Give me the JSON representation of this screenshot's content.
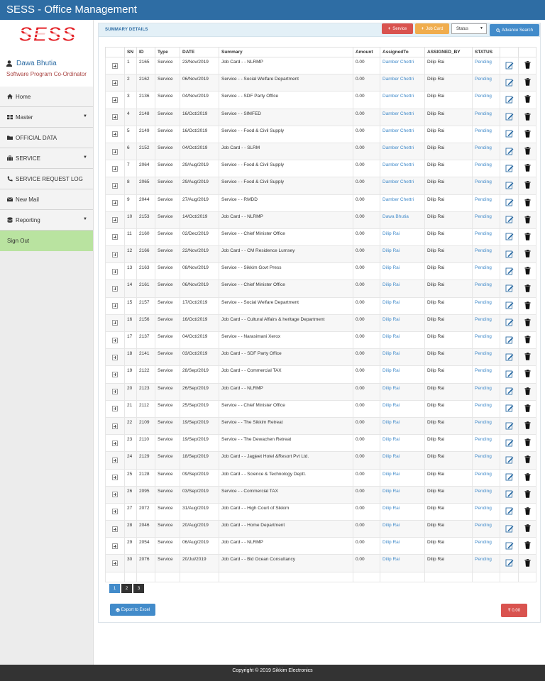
{
  "app": {
    "title": "SESS - Office Management"
  },
  "logo_text": "SESS",
  "user": {
    "name": "Dawa Bhutia",
    "role": "Software Program Co-Ordinator"
  },
  "menu": [
    {
      "label": "Home",
      "icon": "home-icon",
      "caret": false
    },
    {
      "label": "Master",
      "icon": "grid-icon",
      "caret": true
    },
    {
      "label": "OFFICIAL DATA",
      "icon": "folder-icon",
      "caret": false
    },
    {
      "label": "SERVICE",
      "icon": "briefcase-icon",
      "caret": true
    },
    {
      "label": "SERVICE REQUEST LOG",
      "icon": "phone-icon",
      "caret": false
    },
    {
      "label": "New Mail",
      "icon": "envelope-icon",
      "caret": false
    },
    {
      "label": "Reporting",
      "icon": "database-icon",
      "caret": true
    },
    {
      "label": "Sign Out",
      "icon": "",
      "caret": false
    }
  ],
  "summary": {
    "title": "SUMMARY DETAILS",
    "service_label": "Service",
    "jobcard_label": "Job Card",
    "status_label": "Status",
    "advance_search_label": "Advance Search"
  },
  "table": {
    "headers": [
      "",
      "SN",
      "ID",
      "Type",
      "DATE",
      "Summary",
      "Amount",
      "AssignedTo",
      "ASSIGNED_BY",
      "STATUS",
      "",
      ""
    ],
    "rows": [
      [
        "1",
        "2165",
        "Service",
        "23/Nov/2019",
        "Job Card - - NLRMP",
        "0.00",
        "Damber Chettri",
        "Dilip Rai",
        "Pending"
      ],
      [
        "2",
        "2162",
        "Service",
        "06/Nov/2019",
        "Service - - Social Welfare Department",
        "0.00",
        "Damber Chettri",
        "Dilip Rai",
        "Pending"
      ],
      [
        "3",
        "2136",
        "Service",
        "04/Nov/2019",
        "Service - - SDF Party Office",
        "0.00",
        "Damber Chettri",
        "Dilip Rai",
        "Pending"
      ],
      [
        "4",
        "2148",
        "Service",
        "16/Oct/2019",
        "Service - - SIMFED",
        "0.00",
        "Damber Chettri",
        "Dilip Rai",
        "Pending"
      ],
      [
        "5",
        "2149",
        "Service",
        "16/Oct/2019",
        "Service - - Food & Civil Supply",
        "0.00",
        "Damber Chettri",
        "Dilip Rai",
        "Pending"
      ],
      [
        "6",
        "2152",
        "Service",
        "04/Oct/2019",
        "Job Card - - SLRM",
        "0.00",
        "Damber Chettri",
        "Dilip Rai",
        "Pending"
      ],
      [
        "7",
        "2064",
        "Service",
        "29/Aug/2019",
        "Service - - Food & Civil Supply",
        "0.00",
        "Damber Chettri",
        "Dilip Rai",
        "Pending"
      ],
      [
        "8",
        "2065",
        "Service",
        "29/Aug/2019",
        "Service - - Food & Civil Supply",
        "0.00",
        "Damber Chettri",
        "Dilip Rai",
        "Pending"
      ],
      [
        "9",
        "2044",
        "Service",
        "27/Aug/2019",
        "Service - - RMDD",
        "0.00",
        "Damber Chettri",
        "Dilip Rai",
        "Pending"
      ],
      [
        "10",
        "2153",
        "Service",
        "14/Oct/2019",
        "Job Card - - NLRMP",
        "0.00",
        "Dawa Bhutia",
        "Dilip Rai",
        "Pending"
      ],
      [
        "11",
        "2160",
        "Service",
        "02/Dec/2019",
        "Service - - Chief Minister Office",
        "0.00",
        "Dilip Rai",
        "Dilip Rai",
        "Pending"
      ],
      [
        "12",
        "2166",
        "Service",
        "22/Nov/2019",
        "Job Card - - CM Residence Lumsey",
        "0.00",
        "Dilip Rai",
        "Dilip Rai",
        "Pending"
      ],
      [
        "13",
        "2163",
        "Service",
        "08/Nov/2019",
        "Service - - Sikkim Govt Press",
        "0.00",
        "Dilip Rai",
        "Dilip Rai",
        "Pending"
      ],
      [
        "14",
        "2161",
        "Service",
        "06/Nov/2019",
        "Service - - Chief Minister Office",
        "0.00",
        "Dilip Rai",
        "Dilip Rai",
        "Pending"
      ],
      [
        "15",
        "2157",
        "Service",
        "17/Oct/2019",
        "Service - - Social Welfare Department",
        "0.00",
        "Dilip Rai",
        "Dilip Rai",
        "Pending"
      ],
      [
        "16",
        "2156",
        "Service",
        "16/Oct/2019",
        "Job Card - - Cultural Affairs & heritage Department",
        "0.00",
        "Dilip Rai",
        "Dilip Rai",
        "Pending"
      ],
      [
        "17",
        "2137",
        "Service",
        "04/Oct/2019",
        "Service - - Narasimani Xerox",
        "0.00",
        "Dilip Rai",
        "Dilip Rai",
        "Pending"
      ],
      [
        "18",
        "2141",
        "Service",
        "03/Oct/2019",
        "Job Card - - SDF Party Office",
        "0.00",
        "Dilip Rai",
        "Dilip Rai",
        "Pending"
      ],
      [
        "19",
        "2122",
        "Service",
        "28/Sep/2019",
        "Job Card - - Commercial TAX",
        "0.00",
        "Dilip Rai",
        "Dilip Rai",
        "Pending"
      ],
      [
        "20",
        "2123",
        "Service",
        "26/Sep/2019",
        "Job Card - - NLRMP",
        "0.00",
        "Dilip Rai",
        "Dilip Rai",
        "Pending"
      ],
      [
        "21",
        "2112",
        "Service",
        "25/Sep/2019",
        "Service - - Chief Minister Office",
        "0.00",
        "Dilip Rai",
        "Dilip Rai",
        "Pending"
      ],
      [
        "22",
        "2109",
        "Service",
        "19/Sep/2019",
        "Service - - The Sikkim Retreat",
        "0.00",
        "Dilip Rai",
        "Dilip Rai",
        "Pending"
      ],
      [
        "23",
        "2110",
        "Service",
        "19/Sep/2019",
        "Service - - The Dewachen Retreat",
        "0.00",
        "Dilip Rai",
        "Dilip Rai",
        "Pending"
      ],
      [
        "24",
        "2129",
        "Service",
        "18/Sep/2019",
        "Job Card - - Jagjeet Hotel &Resort Pvt Ltd.",
        "0.00",
        "Dilip Rai",
        "Dilip Rai",
        "Pending"
      ],
      [
        "25",
        "2128",
        "Service",
        "09/Sep/2019",
        "Job Card - - Science & Technology Deptt.",
        "0.00",
        "Dilip Rai",
        "Dilip Rai",
        "Pending"
      ],
      [
        "26",
        "2095",
        "Service",
        "03/Sep/2019",
        "Service - - Commercial TAX",
        "0.00",
        "Dilip Rai",
        "Dilip Rai",
        "Pending"
      ],
      [
        "27",
        "2072",
        "Service",
        "31/Aug/2019",
        "Job Card - - High Court of Sikkim",
        "0.00",
        "Dilip Rai",
        "Dilip Rai",
        "Pending"
      ],
      [
        "28",
        "2046",
        "Service",
        "20/Aug/2019",
        "Job Card - - Home Department",
        "0.00",
        "Dilip Rai",
        "Dilip Rai",
        "Pending"
      ],
      [
        "29",
        "2054",
        "Service",
        "06/Aug/2019",
        "Job Card - - NLRMP",
        "0.00",
        "Dilip Rai",
        "Dilip Rai",
        "Pending"
      ],
      [
        "30",
        "2076",
        "Service",
        "20/Jul/2019",
        "Job Card - - Bid Ocean Consultancy",
        "0.00",
        "Dilip Rai",
        "Dilip Rai",
        "Pending"
      ]
    ]
  },
  "pagination": {
    "pages": [
      "1",
      "2",
      "3"
    ],
    "active": "1"
  },
  "export_label": "Export to Excel",
  "total_label": "₹ 0.00",
  "footer": "Copyright © 2019 Sikkim Electronics",
  "colors": {
    "primary": "#2e6da4",
    "danger": "#d9534f",
    "warning": "#f0ad4e",
    "signout": "#b9e3a0"
  }
}
